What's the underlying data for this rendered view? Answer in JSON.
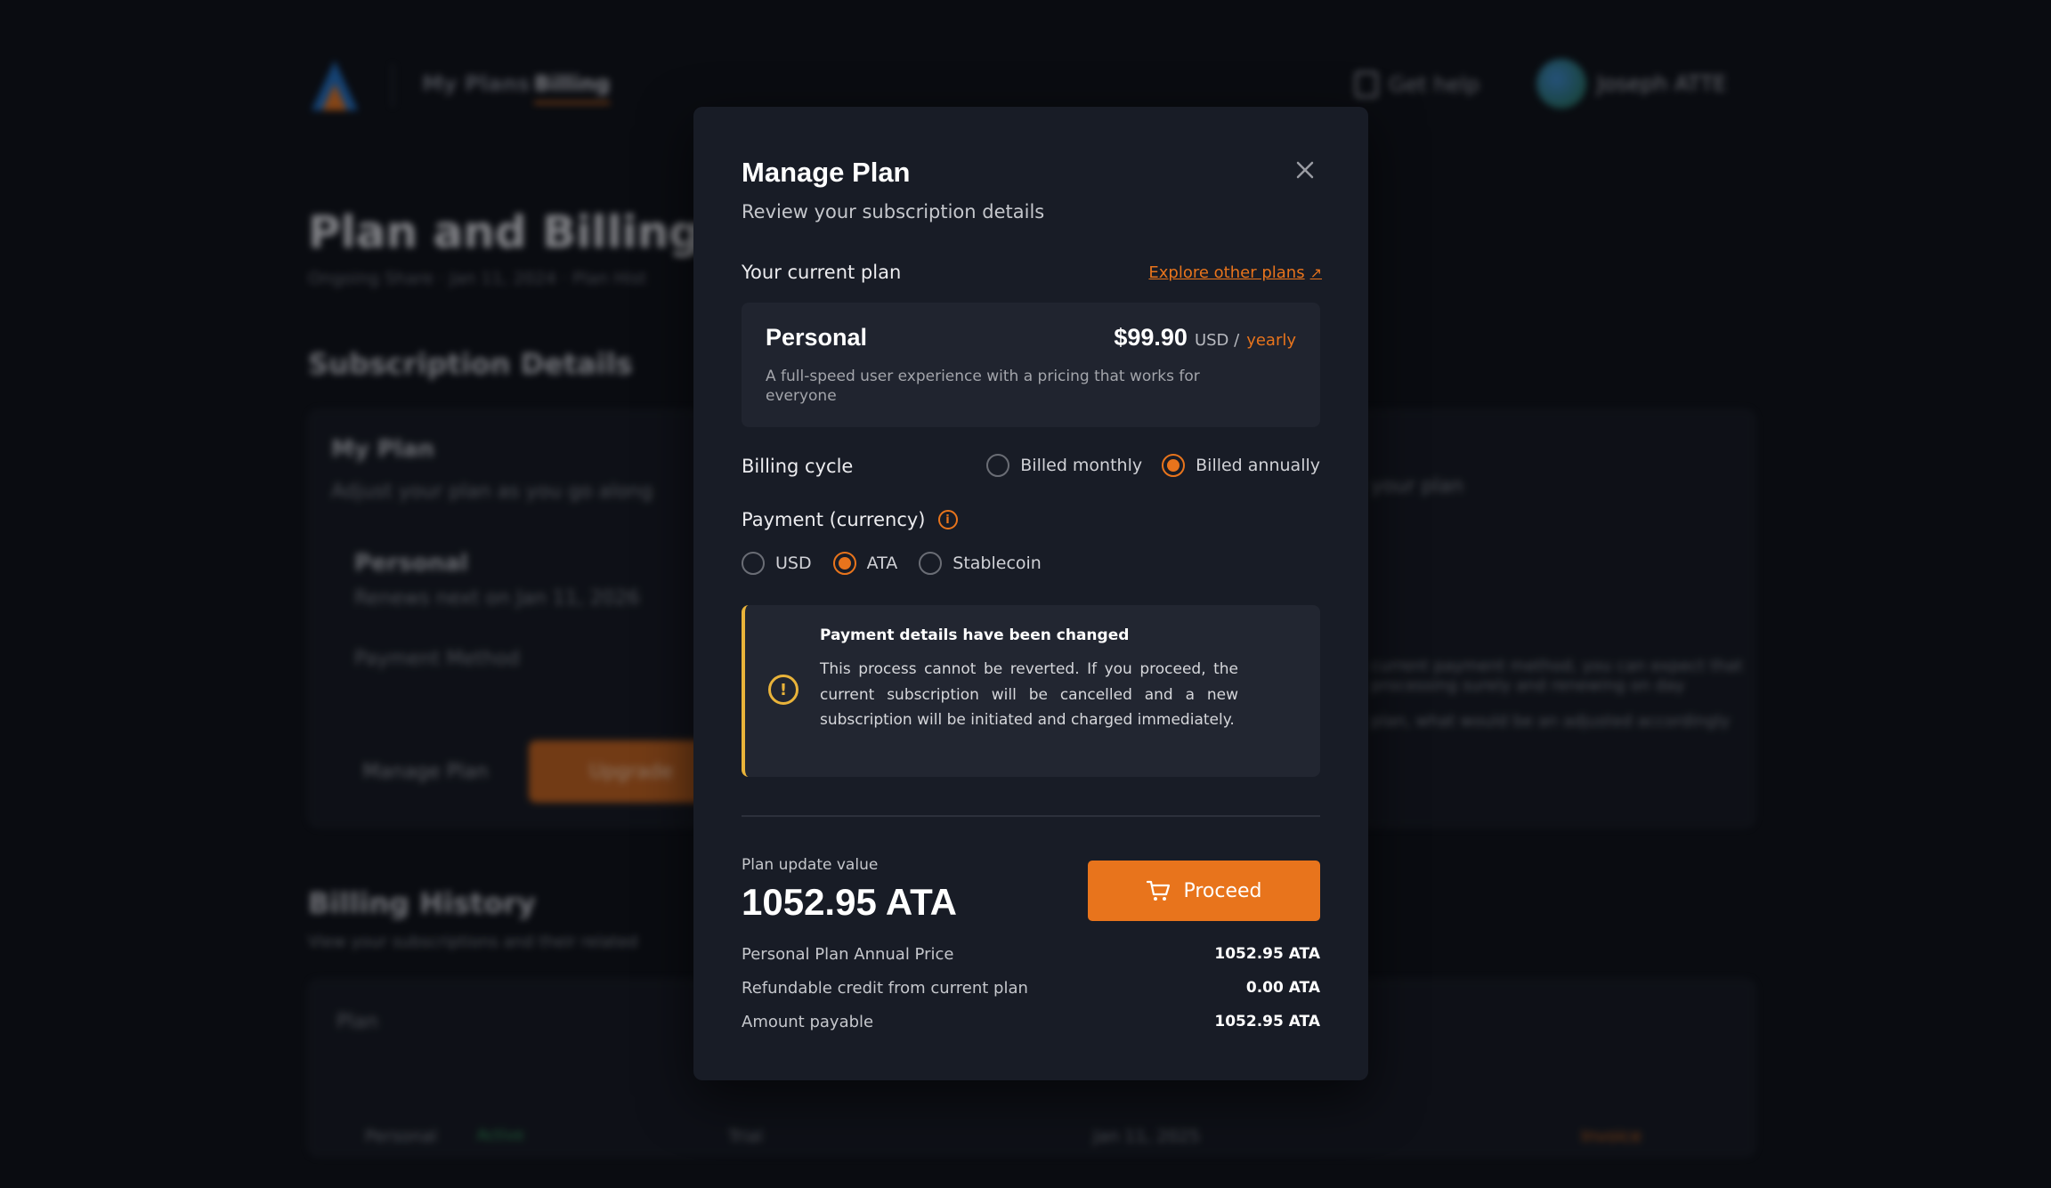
{
  "background": {
    "nav": {
      "links": [
        "My Plans",
        "Billing"
      ],
      "help_label": "Get help",
      "user_name": "Joseph ATTE"
    },
    "page_title": "Plan and Billing",
    "meta": "Ongoing Share  ·  Jan 11, 2024  ·  Plan Hist",
    "subscription_heading": "Subscription Details",
    "my_plan_title": "My Plan",
    "my_plan_sub": "Adjust your plan as you go along",
    "plan_name": "Personal",
    "plan_renew": "Renews next on Jan 11, 2026",
    "payment_method": "Payment Method",
    "manage_plan_label": "Manage Plan",
    "upgrade_label": "Upgrade",
    "right_note": "your plan",
    "right_text_1": "current payment method, you can expect that",
    "right_text_2": "processing surely and renewing on day",
    "right_text_3": "plan, what would be an adjusted accordingly",
    "billing_history_heading": "Billing History",
    "billing_history_sub": "View your subscriptions and their related",
    "table_header": "Plan",
    "row": {
      "plan": "Personal",
      "status": "Active",
      "type": "Trial",
      "date": "Jan 11, 2025",
      "action": "Invoice"
    }
  },
  "modal": {
    "title": "Manage Plan",
    "subtitle": "Review your subscription details",
    "current_plan_label": "Your current plan",
    "explore_link": "Explore other plans",
    "plan": {
      "name": "Personal",
      "price": "$99.90",
      "currency": "USD /",
      "period": "yearly",
      "description": "A full-speed user experience with a pricing that works for everyone"
    },
    "billing_cycle": {
      "label": "Billing cycle",
      "options": [
        "Billed monthly",
        "Billed annually"
      ],
      "selected": "Billed annually"
    },
    "payment": {
      "label": "Payment (currency)",
      "options": [
        "USD",
        "ATA",
        "Stablecoin"
      ],
      "selected": "ATA"
    },
    "alert": {
      "title": "Payment details have been changed",
      "body": "This process cannot be reverted. If you proceed, the current subscription will be cancelled and a new subscription will be initiated and charged immediately."
    },
    "update": {
      "label": "Plan update value",
      "value": "1052.95 ATA",
      "proceed_label": "Proceed"
    },
    "summary": [
      {
        "label": "Personal Plan Annual Price",
        "value": "1052.95 ATA"
      },
      {
        "label": "Refundable credit from current plan",
        "value": "0.00 ATA"
      },
      {
        "label": "Amount payable",
        "value": "1052.95 ATA"
      }
    ]
  },
  "colors": {
    "accent": "#e8741c",
    "warning": "#e9b33a",
    "modal_bg": "#181c26",
    "page_bg": "#0a0c11"
  }
}
